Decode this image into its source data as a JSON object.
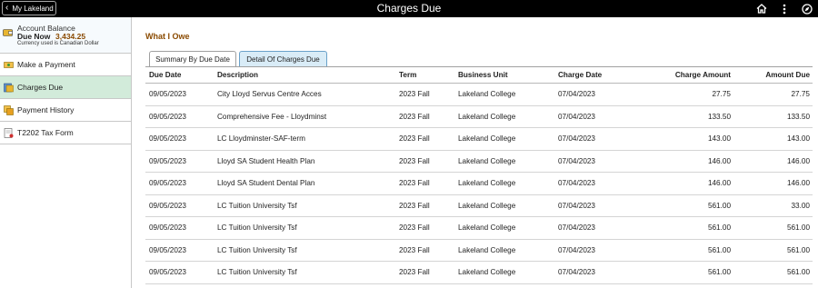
{
  "header": {
    "back_label": "My Lakeland",
    "title": "Charges Due"
  },
  "sidebar": {
    "account": {
      "label": "Account Balance",
      "due_label": "Due Now",
      "amount": "3,434.25",
      "note": "Currency used is Canadian Dollar"
    },
    "items": [
      {
        "label": "Make a Payment",
        "icon": "payment-icon"
      },
      {
        "label": "Charges Due",
        "icon": "charges-icon"
      },
      {
        "label": "Payment History",
        "icon": "history-icon"
      },
      {
        "label": "T2202 Tax Form",
        "icon": "tax-form-icon"
      }
    ]
  },
  "main": {
    "heading": "What I Owe",
    "tabs": [
      {
        "label": "Summary By Due Date"
      },
      {
        "label": "Detail Of Charges Due"
      }
    ],
    "columns": [
      "Due Date",
      "Description",
      "Term",
      "Business Unit",
      "Charge Date",
      "Charge Amount",
      "Amount Due"
    ],
    "rows": [
      [
        "09/05/2023",
        "City Lloyd Servus Centre Acces",
        "2023 Fall",
        "Lakeland College",
        "07/04/2023",
        "27.75",
        "27.75"
      ],
      [
        "09/05/2023",
        "Comprehensive Fee - Lloydminst",
        "2023 Fall",
        "Lakeland College",
        "07/04/2023",
        "133.50",
        "133.50"
      ],
      [
        "09/05/2023",
        "LC Lloydminster-SAF-term",
        "2023 Fall",
        "Lakeland College",
        "07/04/2023",
        "143.00",
        "143.00"
      ],
      [
        "09/05/2023",
        "Lloyd SA Student Health Plan",
        "2023 Fall",
        "Lakeland College",
        "07/04/2023",
        "146.00",
        "146.00"
      ],
      [
        "09/05/2023",
        "Lloyd SA Student Dental Plan",
        "2023 Fall",
        "Lakeland College",
        "07/04/2023",
        "146.00",
        "146.00"
      ],
      [
        "09/05/2023",
        "LC Tuition University Tsf",
        "2023 Fall",
        "Lakeland College",
        "07/04/2023",
        "561.00",
        "33.00"
      ],
      [
        "09/05/2023",
        "LC Tuition University Tsf",
        "2023 Fall",
        "Lakeland College",
        "07/04/2023",
        "561.00",
        "561.00"
      ],
      [
        "09/05/2023",
        "LC Tuition University Tsf",
        "2023 Fall",
        "Lakeland College",
        "07/04/2023",
        "561.00",
        "561.00"
      ],
      [
        "09/05/2023",
        "LC Tuition University Tsf",
        "2023 Fall",
        "Lakeland College",
        "07/04/2023",
        "561.00",
        "561.00"
      ]
    ]
  },
  "colors": {
    "topbar": "#000000",
    "active_nav": "#d2ebda",
    "heading": "#8a4a00",
    "active_tab": "#d9ecf7"
  }
}
